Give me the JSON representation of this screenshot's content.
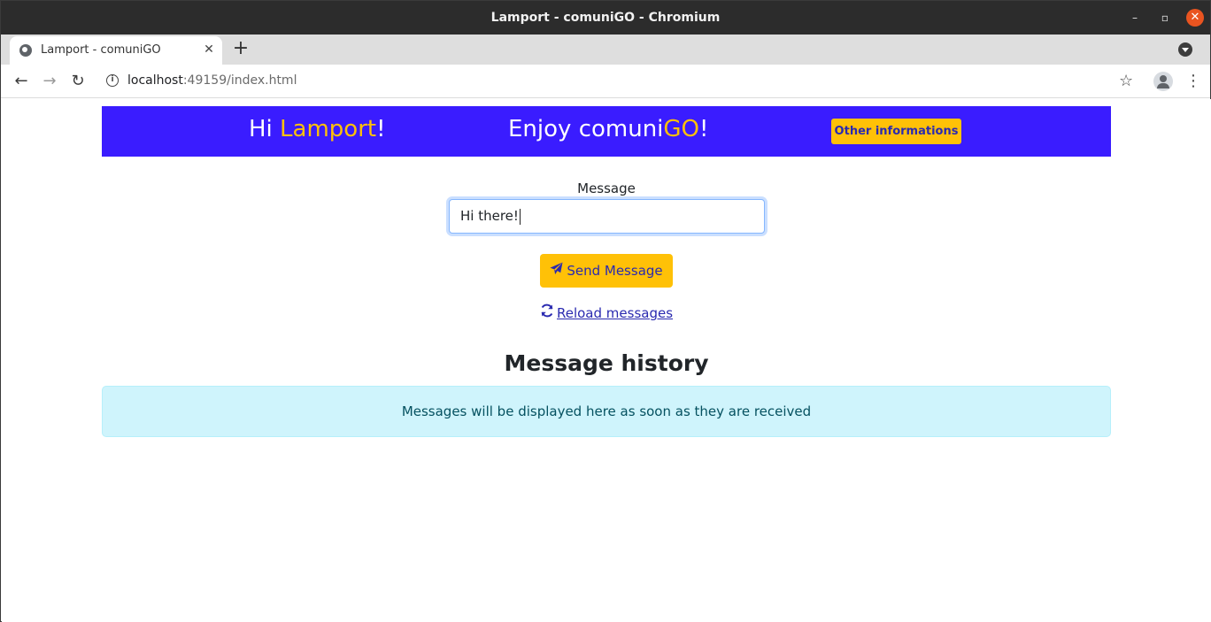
{
  "window": {
    "title": "Lamport - comuniGO - Chromium",
    "minimize_label": "–",
    "maximize_label": "▫",
    "close_label": "✕"
  },
  "tabs": [
    {
      "title": "Lamport - comuniGO",
      "close_label": "✕"
    }
  ],
  "tabstrip": {
    "new_tab_label": "+"
  },
  "toolbar": {
    "back_label": "←",
    "forward_label": "→",
    "reload_label": "↻",
    "info_label": "i",
    "url_host": "localhost",
    "url_rest": ":49159/index.html",
    "bookmark_label": "☆",
    "menu_label": "⋮"
  },
  "banner": {
    "greeting_prefix": "Hi ",
    "user_name": "Lamport",
    "greeting_suffix": "!",
    "enjoy_prefix": "Enjoy comuni",
    "enjoy_accent": "GO",
    "enjoy_suffix": "!",
    "info_button": "Other informations",
    "background_color": "#3a1cff",
    "accent_color": "#ffc107"
  },
  "form": {
    "message_label": "Message",
    "message_value": "Hi there!",
    "send_icon": "paper-plane-icon",
    "send_button": "Send Message",
    "reload_icon": "refresh-icon",
    "reload_link": "Reload messages"
  },
  "history": {
    "title": "Message history",
    "empty_notice": "Messages will be displayed here as soon as they are received"
  }
}
